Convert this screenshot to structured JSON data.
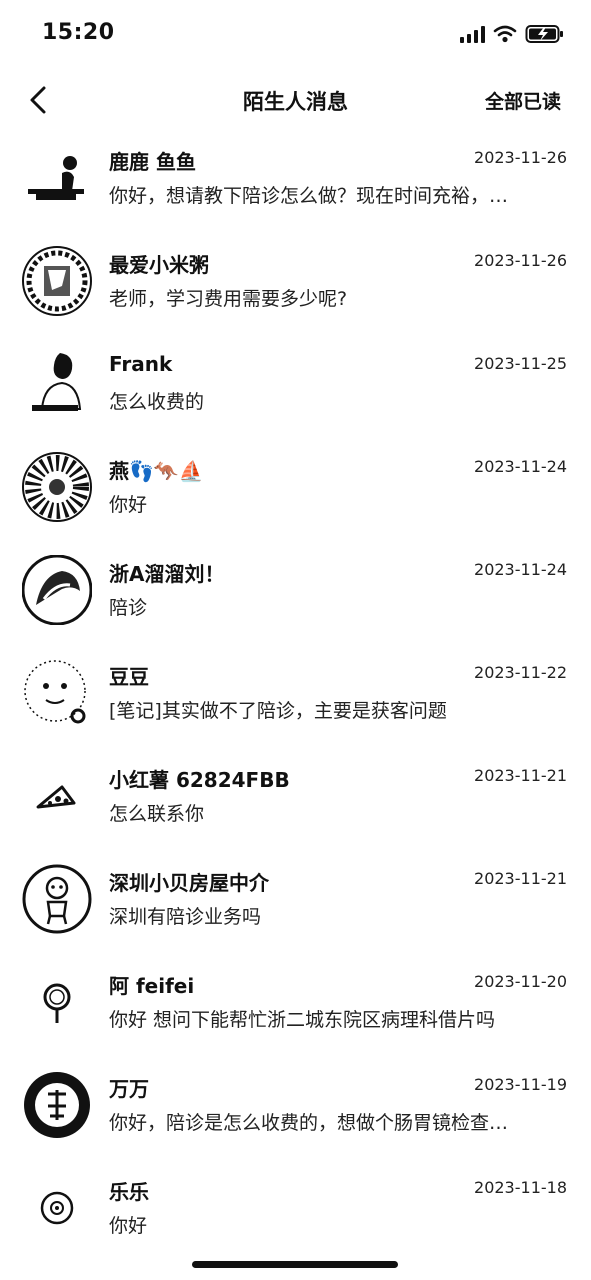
{
  "status": {
    "time": "15:20"
  },
  "nav": {
    "title": "陌生人消息",
    "mark_all_read": "全部已读"
  },
  "messages": [
    {
      "name": "鹿鹿 鱼鱼",
      "date": "2023-11-26",
      "text": "你好，想请教下陪诊怎么做？现在时间充裕，…",
      "avatar": "person-sitting-icon"
    },
    {
      "name": "最爱小米粥",
      "date": "2023-11-26",
      "text": "老师，学习费用需要多少呢?",
      "avatar": "photo-circle-icon"
    },
    {
      "name": "Frank",
      "date": "2023-11-25",
      "text": "怎么收费的",
      "avatar": "person-portrait-icon"
    },
    {
      "name": "燕👣🦘⛵",
      "date": "2023-11-24",
      "text": "你好",
      "avatar": "photo-circle-icon"
    },
    {
      "name": "浙A溜溜刘！",
      "date": "2023-11-24",
      "text": "陪诊",
      "avatar": "photo-circle-icon"
    },
    {
      "name": "豆豆",
      "date": "2023-11-22",
      "text": "[笔记]其实做不了陪诊，主要是获客问题",
      "avatar": "cartoon-face-icon"
    },
    {
      "name": "小红薯 62824FBB",
      "date": "2023-11-21",
      "text": "怎么联系你",
      "avatar": "pizza-icon"
    },
    {
      "name": "深圳小贝房屋中介",
      "date": "2023-11-21",
      "text": "深圳有陪诊业务吗",
      "avatar": "cartoon-person-icon"
    },
    {
      "name": "阿 feifei",
      "date": "2023-11-20",
      "text": "你好 想问下能帮忙浙二城东院区病理科借片吗",
      "avatar": "pin-icon"
    },
    {
      "name": "万万",
      "date": "2023-11-19",
      "text": "你好，陪诊是怎么收费的，想做个肠胃镜检查…",
      "avatar": "calligraphy-circle-icon"
    },
    {
      "name": "乐乐",
      "date": "2023-11-18",
      "text": "你好",
      "avatar": "small-disc-icon"
    }
  ]
}
